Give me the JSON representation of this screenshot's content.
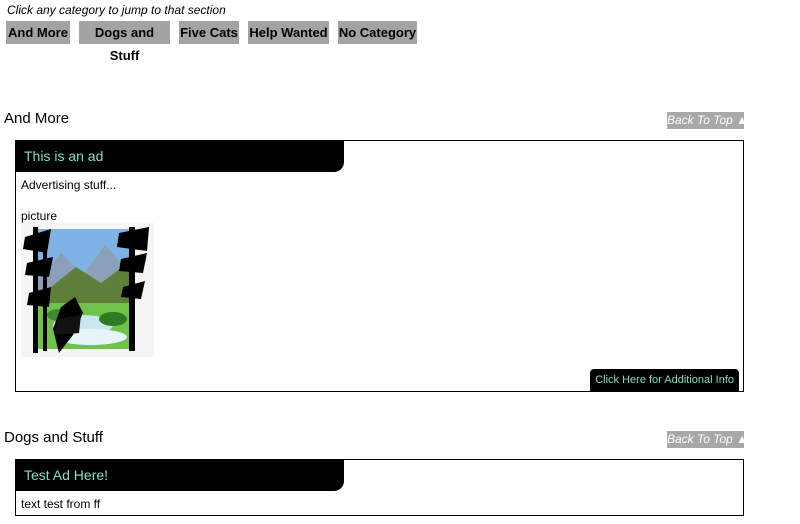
{
  "instructions": "Click any category to jump to that section",
  "categories": [
    "And More",
    "Dogs and Stuff",
    "Five Cats",
    "Help Wanted",
    "No Category"
  ],
  "back_to_top": "Back To Top ▲",
  "sections": [
    {
      "title": "And More",
      "ad": {
        "headline": "This is an ad",
        "body": "Advertising stuff...",
        "picture_label": "picture",
        "more_info": "Click Here for Additional Info"
      }
    },
    {
      "title": "Dogs and Stuff",
      "ad": {
        "headline": "Test Ad Here!",
        "body": "text test from ff"
      }
    }
  ],
  "colors": {
    "button_gray": "#a3a3a3",
    "ad_header_bg": "#000000",
    "ad_header_text": "#7fe0c0"
  }
}
